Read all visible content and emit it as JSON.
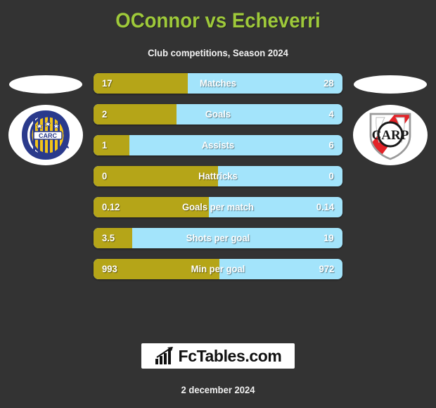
{
  "header": {
    "title": "OConnor vs Echeverri",
    "subtitle": "Club competitions, Season 2024",
    "title_color": "#9ec93a"
  },
  "teams": {
    "home": {
      "crest_name": "rosario-central-crest",
      "monogram": "CARC"
    },
    "away": {
      "crest_name": "river-plate-crest",
      "monogram": "CARP"
    }
  },
  "colors": {
    "background": "#333333",
    "home_bar": "#b5a518",
    "away_bar": "#a3e4fb",
    "text": "#ffffff"
  },
  "footer": {
    "brand": "FcTables.com",
    "brand_icon": "bar-chart-arrow-icon",
    "date": "2 december 2024"
  },
  "chart_data": {
    "type": "bar",
    "title": "OConnor vs Echeverri",
    "subtitle": "Club competitions, Season 2024",
    "orientation": "horizontal-diverging",
    "series": [
      {
        "name": "OConnor",
        "side": "left",
        "color": "#b5a518",
        "values": [
          17,
          2,
          1,
          0,
          0.12,
          3.5,
          993
        ],
        "labels": [
          "17",
          "2",
          "1",
          "0",
          "0.12",
          "3.5",
          "993"
        ]
      },
      {
        "name": "Echeverri",
        "side": "right",
        "color": "#a3e4fb",
        "values": [
          28,
          4,
          6,
          0,
          0.14,
          19,
          972
        ],
        "labels": [
          "28",
          "4",
          "6",
          "0",
          "0.14",
          "19",
          "972"
        ]
      }
    ],
    "categories": [
      "Matches",
      "Goals",
      "Assists",
      "Hattricks",
      "Goals per match",
      "Shots per goal",
      "Min per goal"
    ],
    "rows": [
      {
        "label": "Matches",
        "home": "17",
        "away": "28",
        "fill_pct": 37.8
      },
      {
        "label": "Goals",
        "home": "2",
        "away": "4",
        "fill_pct": 33.3
      },
      {
        "label": "Assists",
        "home": "1",
        "away": "6",
        "fill_pct": 14.3
      },
      {
        "label": "Hattricks",
        "home": "0",
        "away": "0",
        "fill_pct": 50.0
      },
      {
        "label": "Goals per match",
        "home": "0.12",
        "away": "0.14",
        "fill_pct": 46.2
      },
      {
        "label": "Shots per goal",
        "home": "3.5",
        "away": "19",
        "fill_pct": 15.6
      },
      {
        "label": "Min per goal",
        "home": "993",
        "away": "972",
        "fill_pct": 50.5
      }
    ],
    "grid": false,
    "legend": "none"
  }
}
